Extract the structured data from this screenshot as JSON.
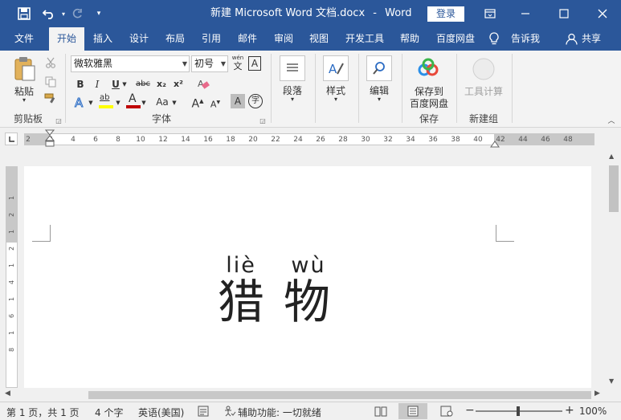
{
  "title_bar": {
    "document_name": "新建 Microsoft Word 文档.docx",
    "separator": "-",
    "app_name": "Word",
    "login_label": "登录"
  },
  "tabs": [
    "文件",
    "开始",
    "插入",
    "设计",
    "布局",
    "引用",
    "邮件",
    "审阅",
    "视图",
    "开发工具",
    "帮助",
    "百度网盘"
  ],
  "active_tab": "开始",
  "tell_me": "告诉我",
  "share": "共享",
  "clipboard": {
    "paste_label": "粘贴",
    "group_label": "剪贴板"
  },
  "font": {
    "font_name": "微软雅黑",
    "font_size": "初号",
    "group_label": "字体",
    "bold": "B",
    "italic": "I",
    "underline": "U",
    "strikethrough": "abc",
    "subscript": "x₂",
    "superscript": "x²",
    "phonetic_top": "wén",
    "phonetic_bottom": "文",
    "border_char": "A",
    "highlight_label": "ab",
    "font_color_label": "A",
    "change_case": "Aa",
    "grow_font": "A",
    "shrink_font": "A",
    "char_shading": "A",
    "enclose": "字"
  },
  "paragraph": {
    "label": "段落"
  },
  "styles": {
    "label": "样式"
  },
  "editing": {
    "label": "编辑"
  },
  "save_group": {
    "button_line1": "保存到",
    "button_line2": "百度网盘",
    "group_label": "保存"
  },
  "new_group": {
    "button_label": "工具计算",
    "group_label": "新建组"
  },
  "ruler": {
    "h_numbers": [
      "2",
      "2",
      "4",
      "6",
      "8",
      "10",
      "12",
      "14",
      "16",
      "18",
      "20",
      "22",
      "24",
      "26",
      "28",
      "30",
      "32",
      "34",
      "36",
      "38",
      "40",
      "42",
      "44",
      "46",
      "48"
    ],
    "v_numbers": [
      "1",
      "2",
      "1",
      "2",
      "1",
      "4",
      "1",
      "6",
      "1",
      "8"
    ]
  },
  "document": {
    "pinyin": [
      "liè",
      "wù"
    ],
    "characters": [
      "猎",
      "物"
    ]
  },
  "status_bar": {
    "page_info": "第 1 页，共 1 页",
    "word_count": "4 个字",
    "language": "英语(美国)",
    "accessibility": "辅助功能: 一切就绪",
    "zoom": "100%"
  },
  "colors": {
    "accent": "#2b579a",
    "highlight": "#ffff00",
    "font_color": "#c00000"
  }
}
